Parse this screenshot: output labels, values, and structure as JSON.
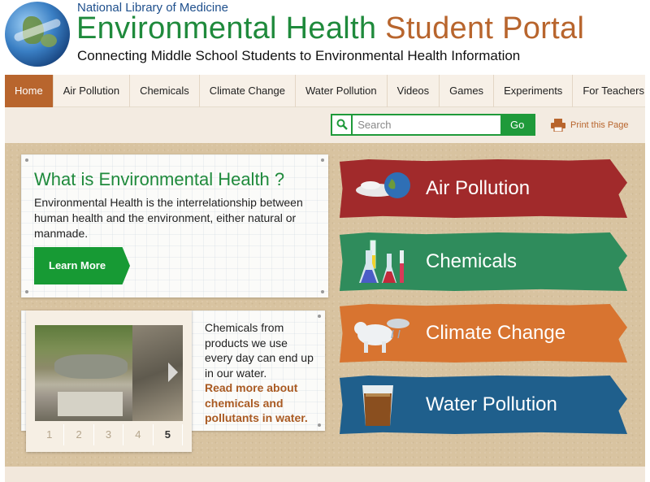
{
  "header": {
    "org": "National Library of Medicine",
    "title_part1": "Environmental Health",
    "title_part2": "Student Portal",
    "subtitle": "Connecting Middle School Students to Environmental Health Information"
  },
  "nav": {
    "items": [
      {
        "label": "Home",
        "active": true
      },
      {
        "label": "Air Pollution"
      },
      {
        "label": "Chemicals"
      },
      {
        "label": "Climate Change"
      },
      {
        "label": "Water Pollution"
      },
      {
        "label": "Videos"
      },
      {
        "label": "Games"
      },
      {
        "label": "Experiments"
      },
      {
        "label": "For Teachers"
      }
    ]
  },
  "search": {
    "placeholder": "Search",
    "go_label": "Go",
    "icon": "search-icon"
  },
  "print": {
    "label": "Print this Page",
    "icon": "printer-icon"
  },
  "intro": {
    "heading": "What is Environmental Health ?",
    "body": "Environmental Health is the interrelationship between human health and the environment, either natural or manmade.",
    "button": "Learn More"
  },
  "feature": {
    "text": "Chemicals from products we use every day can end up in our water.",
    "link": "Read more about chemicals and pollutants in water.",
    "pages": [
      "1",
      "2",
      "3",
      "4",
      "5"
    ],
    "active_page": "5"
  },
  "topics": [
    {
      "label": "Air Pollution",
      "color": "#a12a2b",
      "icon": "globe-smokestack-icon"
    },
    {
      "label": "Chemicals",
      "color": "#2f8c5c",
      "icon": "test-tubes-icon"
    },
    {
      "label": "Climate Change",
      "color": "#d87430",
      "icon": "polar-bear-icon"
    },
    {
      "label": "Water Pollution",
      "color": "#1f5f8c",
      "icon": "dirty-water-glass-icon"
    }
  ],
  "colors": {
    "green": "#1f8a3c",
    "brown": "#b8652d"
  }
}
